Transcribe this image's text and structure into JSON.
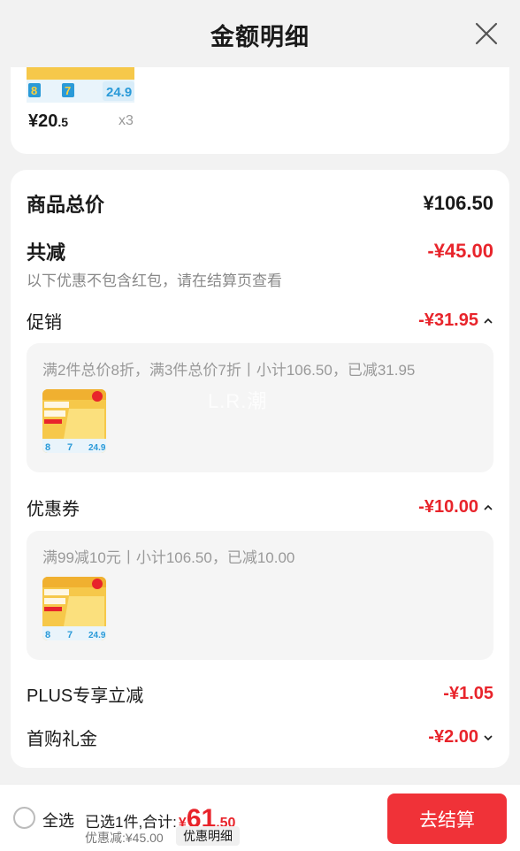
{
  "header": {
    "title": "金额明细"
  },
  "top_item": {
    "price_int": "¥20",
    "price_dec": ".5",
    "qty": "x3"
  },
  "summary": {
    "goods_total_label": "商品总价",
    "goods_total_value": "¥106.50",
    "total_discount_label": "共减",
    "total_discount_value": "-¥45.00",
    "note": "以下优惠不包含红包，请在结算页查看"
  },
  "promotion": {
    "label": "促销",
    "value": "-¥31.95",
    "desc": "满2件总价8折，满3件总价7折丨小计106.50，已减31.95",
    "watermark": "L.R.潮"
  },
  "coupon": {
    "label": "优惠券",
    "value": "-¥10.00",
    "desc": "满99减10元丨小计106.50，已减10.00"
  },
  "plus": {
    "label": "PLUS专享立减",
    "value": "-¥1.05"
  },
  "first_gift": {
    "label": "首购礼金",
    "value": "-¥2.00"
  },
  "bottom_bar": {
    "select_all": "全选",
    "selected_text": "已选1件,合计:",
    "currency": "¥",
    "total_int": "61",
    "total_dec": ".50",
    "discount_line": "优惠减:¥45.00",
    "detail_tag": "优惠明细",
    "checkout": "去结算"
  },
  "colors": {
    "accent": "#e8242b",
    "checkout_bg": "#f03238",
    "product_yellow": "#f6c84a",
    "product_blue": "#2a9ad8"
  },
  "icons": [
    "close-icon",
    "chevron-up-icon",
    "chevron-down-icon",
    "radio-unchecked-icon"
  ]
}
